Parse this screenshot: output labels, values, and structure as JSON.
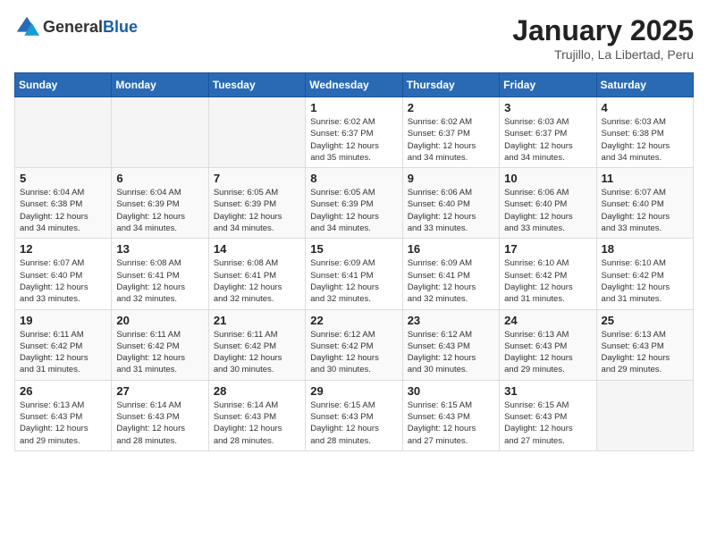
{
  "header": {
    "logo_general": "General",
    "logo_blue": "Blue",
    "month_year": "January 2025",
    "location": "Trujillo, La Libertad, Peru"
  },
  "days_of_week": [
    "Sunday",
    "Monday",
    "Tuesday",
    "Wednesday",
    "Thursday",
    "Friday",
    "Saturday"
  ],
  "weeks": [
    [
      {
        "day": "",
        "info": ""
      },
      {
        "day": "",
        "info": ""
      },
      {
        "day": "",
        "info": ""
      },
      {
        "day": "1",
        "info": "Sunrise: 6:02 AM\nSunset: 6:37 PM\nDaylight: 12 hours\nand 35 minutes."
      },
      {
        "day": "2",
        "info": "Sunrise: 6:02 AM\nSunset: 6:37 PM\nDaylight: 12 hours\nand 34 minutes."
      },
      {
        "day": "3",
        "info": "Sunrise: 6:03 AM\nSunset: 6:37 PM\nDaylight: 12 hours\nand 34 minutes."
      },
      {
        "day": "4",
        "info": "Sunrise: 6:03 AM\nSunset: 6:38 PM\nDaylight: 12 hours\nand 34 minutes."
      }
    ],
    [
      {
        "day": "5",
        "info": "Sunrise: 6:04 AM\nSunset: 6:38 PM\nDaylight: 12 hours\nand 34 minutes."
      },
      {
        "day": "6",
        "info": "Sunrise: 6:04 AM\nSunset: 6:39 PM\nDaylight: 12 hours\nand 34 minutes."
      },
      {
        "day": "7",
        "info": "Sunrise: 6:05 AM\nSunset: 6:39 PM\nDaylight: 12 hours\nand 34 minutes."
      },
      {
        "day": "8",
        "info": "Sunrise: 6:05 AM\nSunset: 6:39 PM\nDaylight: 12 hours\nand 34 minutes."
      },
      {
        "day": "9",
        "info": "Sunrise: 6:06 AM\nSunset: 6:40 PM\nDaylight: 12 hours\nand 33 minutes."
      },
      {
        "day": "10",
        "info": "Sunrise: 6:06 AM\nSunset: 6:40 PM\nDaylight: 12 hours\nand 33 minutes."
      },
      {
        "day": "11",
        "info": "Sunrise: 6:07 AM\nSunset: 6:40 PM\nDaylight: 12 hours\nand 33 minutes."
      }
    ],
    [
      {
        "day": "12",
        "info": "Sunrise: 6:07 AM\nSunset: 6:40 PM\nDaylight: 12 hours\nand 33 minutes."
      },
      {
        "day": "13",
        "info": "Sunrise: 6:08 AM\nSunset: 6:41 PM\nDaylight: 12 hours\nand 32 minutes."
      },
      {
        "day": "14",
        "info": "Sunrise: 6:08 AM\nSunset: 6:41 PM\nDaylight: 12 hours\nand 32 minutes."
      },
      {
        "day": "15",
        "info": "Sunrise: 6:09 AM\nSunset: 6:41 PM\nDaylight: 12 hours\nand 32 minutes."
      },
      {
        "day": "16",
        "info": "Sunrise: 6:09 AM\nSunset: 6:41 PM\nDaylight: 12 hours\nand 32 minutes."
      },
      {
        "day": "17",
        "info": "Sunrise: 6:10 AM\nSunset: 6:42 PM\nDaylight: 12 hours\nand 31 minutes."
      },
      {
        "day": "18",
        "info": "Sunrise: 6:10 AM\nSunset: 6:42 PM\nDaylight: 12 hours\nand 31 minutes."
      }
    ],
    [
      {
        "day": "19",
        "info": "Sunrise: 6:11 AM\nSunset: 6:42 PM\nDaylight: 12 hours\nand 31 minutes."
      },
      {
        "day": "20",
        "info": "Sunrise: 6:11 AM\nSunset: 6:42 PM\nDaylight: 12 hours\nand 31 minutes."
      },
      {
        "day": "21",
        "info": "Sunrise: 6:11 AM\nSunset: 6:42 PM\nDaylight: 12 hours\nand 30 minutes."
      },
      {
        "day": "22",
        "info": "Sunrise: 6:12 AM\nSunset: 6:42 PM\nDaylight: 12 hours\nand 30 minutes."
      },
      {
        "day": "23",
        "info": "Sunrise: 6:12 AM\nSunset: 6:43 PM\nDaylight: 12 hours\nand 30 minutes."
      },
      {
        "day": "24",
        "info": "Sunrise: 6:13 AM\nSunset: 6:43 PM\nDaylight: 12 hours\nand 29 minutes."
      },
      {
        "day": "25",
        "info": "Sunrise: 6:13 AM\nSunset: 6:43 PM\nDaylight: 12 hours\nand 29 minutes."
      }
    ],
    [
      {
        "day": "26",
        "info": "Sunrise: 6:13 AM\nSunset: 6:43 PM\nDaylight: 12 hours\nand 29 minutes."
      },
      {
        "day": "27",
        "info": "Sunrise: 6:14 AM\nSunset: 6:43 PM\nDaylight: 12 hours\nand 28 minutes."
      },
      {
        "day": "28",
        "info": "Sunrise: 6:14 AM\nSunset: 6:43 PM\nDaylight: 12 hours\nand 28 minutes."
      },
      {
        "day": "29",
        "info": "Sunrise: 6:15 AM\nSunset: 6:43 PM\nDaylight: 12 hours\nand 28 minutes."
      },
      {
        "day": "30",
        "info": "Sunrise: 6:15 AM\nSunset: 6:43 PM\nDaylight: 12 hours\nand 27 minutes."
      },
      {
        "day": "31",
        "info": "Sunrise: 6:15 AM\nSunset: 6:43 PM\nDaylight: 12 hours\nand 27 minutes."
      },
      {
        "day": "",
        "info": ""
      }
    ]
  ]
}
